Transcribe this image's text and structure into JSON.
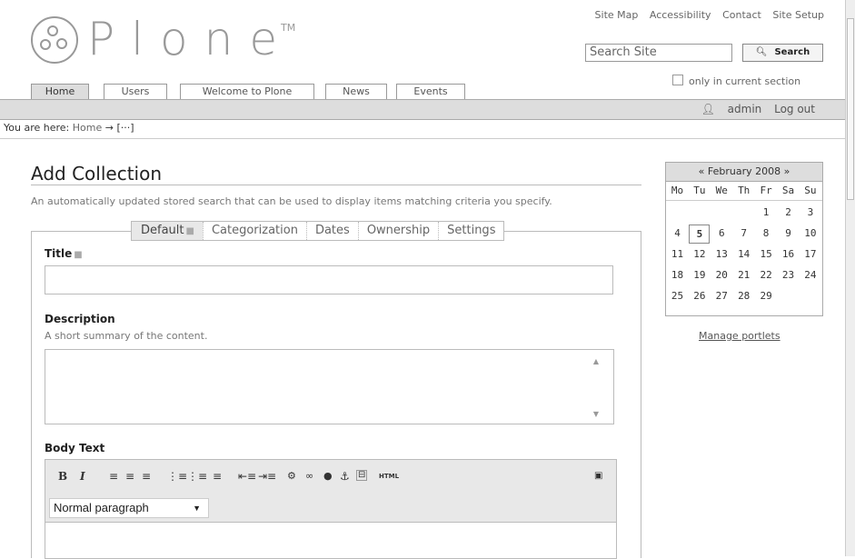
{
  "logo": {
    "word": "Plone",
    "tm": "TM"
  },
  "site_actions": [
    "Site Map",
    "Accessibility",
    "Contact",
    "Site Setup"
  ],
  "search": {
    "value": "Search Site",
    "button_label": "Search",
    "only_section_label": "only in current section"
  },
  "global_tabs": [
    "Home",
    "Users",
    "Welcome to Plone",
    "News",
    "Events"
  ],
  "user": {
    "name": "admin",
    "logout_label": "Log out"
  },
  "breadcrumb": {
    "prefix": "You are here:",
    "home": "Home",
    "arrow": "→",
    "rest": "[···]"
  },
  "main": {
    "title": "Add Collection",
    "description": "An automatically updated stored search that can be used to display items matching criteria you specify."
  },
  "form_tabs": [
    "Default",
    "Categorization",
    "Dates",
    "Ownership",
    "Settings"
  ],
  "fields": {
    "title_label": "Title",
    "title_value": "",
    "description_label": "Description",
    "description_help": "A short summary of the content.",
    "body_label": "Body Text"
  },
  "editor": {
    "format_value": "Normal paragraph",
    "html_label": "HTML"
  },
  "calendar": {
    "prev": "«",
    "month": "February 2008",
    "next": "»",
    "weekdays": [
      "Mo",
      "Tu",
      "We",
      "Th",
      "Fr",
      "Sa",
      "Su"
    ],
    "weeks": [
      [
        "",
        "",
        "",
        "",
        "1",
        "2",
        "3"
      ],
      [
        "4",
        "5",
        "6",
        "7",
        "8",
        "9",
        "10"
      ],
      [
        "11",
        "12",
        "13",
        "14",
        "15",
        "16",
        "17"
      ],
      [
        "18",
        "19",
        "20",
        "21",
        "22",
        "23",
        "24"
      ],
      [
        "25",
        "26",
        "27",
        "28",
        "29",
        "",
        ""
      ]
    ],
    "today": "5"
  },
  "manage_portlets_label": "Manage portlets"
}
